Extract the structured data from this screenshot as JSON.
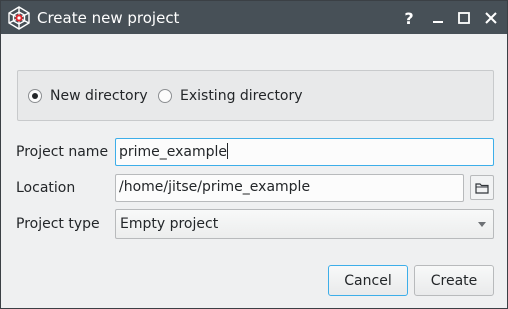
{
  "window": {
    "title": "Create new project",
    "controls": {
      "help": "?",
      "minimize": "—",
      "maximize": "☐",
      "close": "✕"
    },
    "icon": "spider-web-logo-icon"
  },
  "location_mode": {
    "options": [
      {
        "label": "New directory",
        "selected": true
      },
      {
        "label": "Existing directory",
        "selected": false
      }
    ]
  },
  "form": {
    "project_name": {
      "label": "Project name",
      "value": "prime_example"
    },
    "location": {
      "label": "Location",
      "value": "/home/jitse/prime_example",
      "browse_icon": "folder-icon"
    },
    "project_type": {
      "label": "Project type",
      "value": "Empty project"
    }
  },
  "buttons": {
    "cancel": "Cancel",
    "create": "Create"
  },
  "colors": {
    "titlebar": "#475057",
    "focus": "#3daee9",
    "background": "#eff0f1"
  }
}
